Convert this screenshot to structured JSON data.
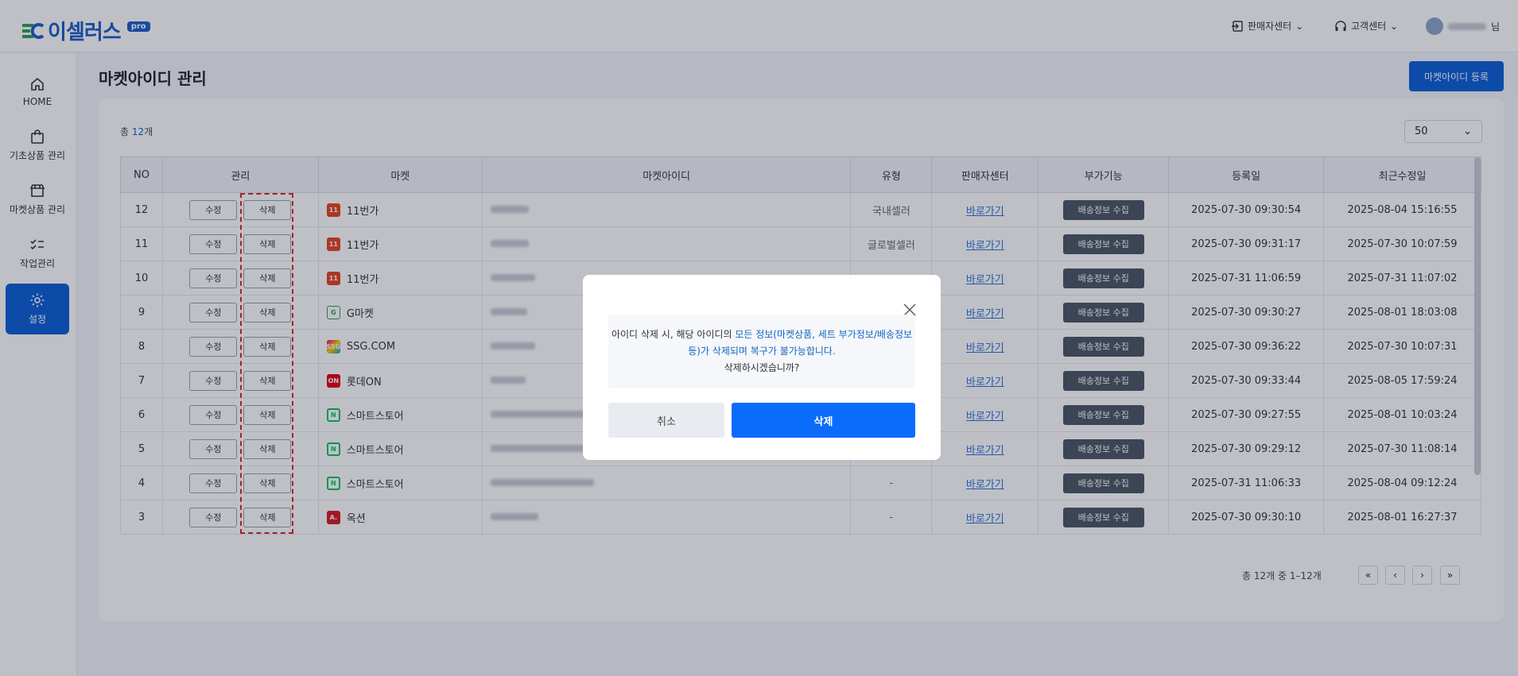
{
  "header": {
    "logo_text": "이셀러스",
    "logo_badge": "pro",
    "seller_center": "판매자센터",
    "customer_center": "고객센터",
    "user_suffix": "님"
  },
  "sidebar": {
    "items": [
      {
        "label": "HOME",
        "icon": "home-icon"
      },
      {
        "label": "기초상품 관리",
        "icon": "bag-icon"
      },
      {
        "label": "마켓상품 관리",
        "icon": "store-icon"
      },
      {
        "label": "작업관리",
        "icon": "checklist-icon"
      },
      {
        "label": "설정",
        "icon": "gear-icon",
        "active": true
      }
    ]
  },
  "page": {
    "title": "마켓아이디 관리",
    "register_button": "마켓아이디 등록",
    "total_prefix": "총 ",
    "total_count": "12",
    "total_suffix": "개",
    "per_page": "50"
  },
  "table": {
    "columns": [
      "NO",
      "관리",
      "마켓",
      "마켓아이디",
      "유형",
      "판매자센터",
      "부가기능",
      "등록일",
      "최근수정일"
    ],
    "edit_label": "수정",
    "delete_label": "삭제",
    "go_label": "바로가기",
    "ship_label": "배송정보 수집",
    "rows": [
      {
        "no": "12",
        "market": "11번가",
        "type": "국내셀러",
        "created": "2025-07-30 09:30:54",
        "updated": "2025-08-04 15:16:55"
      },
      {
        "no": "11",
        "market": "11번가",
        "type": "글로벌셀러",
        "created": "2025-07-30 09:31:17",
        "updated": "2025-07-30 10:07:59"
      },
      {
        "no": "10",
        "market": "11번가",
        "type": "",
        "created": "2025-07-31 11:06:59",
        "updated": "2025-07-31 11:07:02"
      },
      {
        "no": "9",
        "market": "G마켓",
        "type": "",
        "created": "2025-07-30 09:30:27",
        "updated": "2025-08-01 18:03:08"
      },
      {
        "no": "8",
        "market": "SSG.COM",
        "type": "",
        "created": "2025-07-30 09:36:22",
        "updated": "2025-07-30 10:07:31"
      },
      {
        "no": "7",
        "market": "롯데ON",
        "type": "",
        "created": "2025-07-30 09:33:44",
        "updated": "2025-08-05 17:59:24"
      },
      {
        "no": "6",
        "market": "스마트스토어",
        "type": "",
        "created": "2025-07-30 09:27:55",
        "updated": "2025-08-01 10:03:24"
      },
      {
        "no": "5",
        "market": "스마트스토어",
        "type": "",
        "created": "2025-07-30 09:29:12",
        "updated": "2025-07-30 11:08:14"
      },
      {
        "no": "4",
        "market": "스마트스토어",
        "type": "-",
        "created": "2025-07-31 11:06:33",
        "updated": "2025-08-04 09:12:24"
      },
      {
        "no": "3",
        "market": "옥션",
        "type": "-",
        "created": "2025-07-30 09:30:10",
        "updated": "2025-08-01 16:27:37"
      }
    ]
  },
  "pagination": {
    "info": "총 12개 중 1–12개",
    "first": "«",
    "prev": "‹",
    "next": "›",
    "last": "»"
  },
  "modal": {
    "msg_part1": "아이디 삭제 시, 해당 아이디의 ",
    "msg_highlight": "모든 정보(마켓상품, 세트 부가정보/배송정보 등)가 삭제되며 복구가 불가능합니다.",
    "msg_question": "삭제하시겠습니까?",
    "cancel_label": "취소",
    "delete_label": "삭제"
  },
  "colors": {
    "primary": "#0b5ed7",
    "delete_button": "#0b6cfb",
    "link": "#2b6fd8",
    "highlight_border": "#e02424"
  }
}
